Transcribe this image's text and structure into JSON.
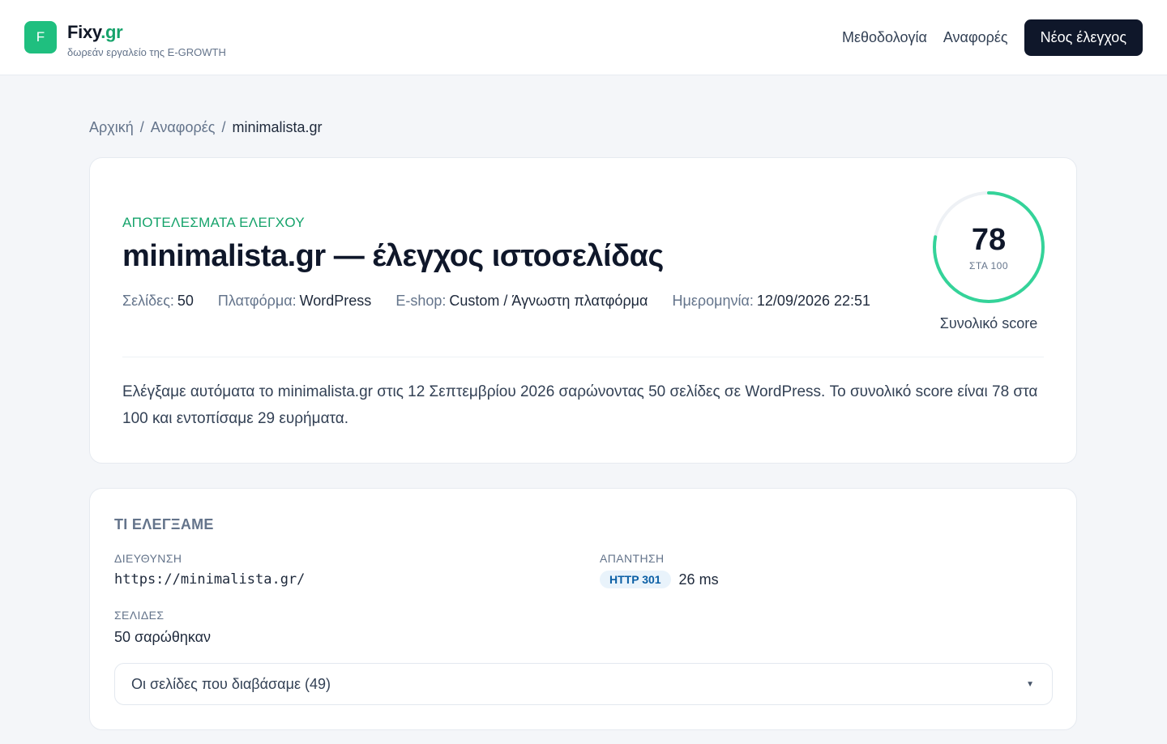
{
  "header": {
    "logo_letter": "F",
    "brand_name": "Fixy",
    "brand_tld": ".gr",
    "brand_sub": "δωρεάν εργαλείο της E-GROWTH",
    "nav": [
      {
        "label": "Μεθοδολογία"
      },
      {
        "label": "Αναφορές"
      }
    ],
    "cta_label": "Νέος έλεγχος"
  },
  "breadcrumb": {
    "items": [
      "Αρχική",
      "Αναφορές"
    ],
    "current": "minimalista.gr",
    "separator": "/"
  },
  "report": {
    "eyebrow": "ΑΠΟΤΕΛΕΣΜΑΤΑ ΕΛΕΓΧΟΥ",
    "title": "minimalista.gr — έλεγχος ιστοσελίδας",
    "meta": [
      {
        "label": "Σελίδες:",
        "value": "50"
      },
      {
        "label": "Πλατφόρμα:",
        "value": "WordPress"
      },
      {
        "label": "E-shop:",
        "value": "Custom / Άγνωστη πλατφόρμα"
      },
      {
        "label": "Ημερομηνία:",
        "value": "12/09/2026 22:51"
      }
    ],
    "score": {
      "value": "78",
      "max": 100,
      "of_label": "ΣΤΑ 100",
      "caption": "Συνολικό score",
      "color": "#34d399",
      "track_color": "#eef1f5"
    },
    "summary": "Ελέγξαμε αυτόματα το minimalista.gr στις 12 Σεπτεμβρίου 2026 σαρώνοντας 50 σελίδες σε WordPress. Το συνολικό score είναι 78 στα 100 και εντοπίσαμε 29 ευρήματα."
  },
  "checked": {
    "title": "ΤΙ ΕΛΕΓΞΑΜΕ",
    "address_label": "ΔΙΕΥΘΥΝΣΗ",
    "address_value": "https://minimalista.gr/",
    "response_label": "ΑΠΑΝΤΗΣΗ",
    "response_status": "HTTP 301",
    "response_time": "26 ms",
    "pages_label": "ΣΕΛΙΔΕΣ",
    "pages_value": "50 σαρώθηκαν",
    "accordion_label": "Οι σελίδες που διαβάσαμε (49)",
    "accordion_icon": "chevron-down-icon"
  }
}
